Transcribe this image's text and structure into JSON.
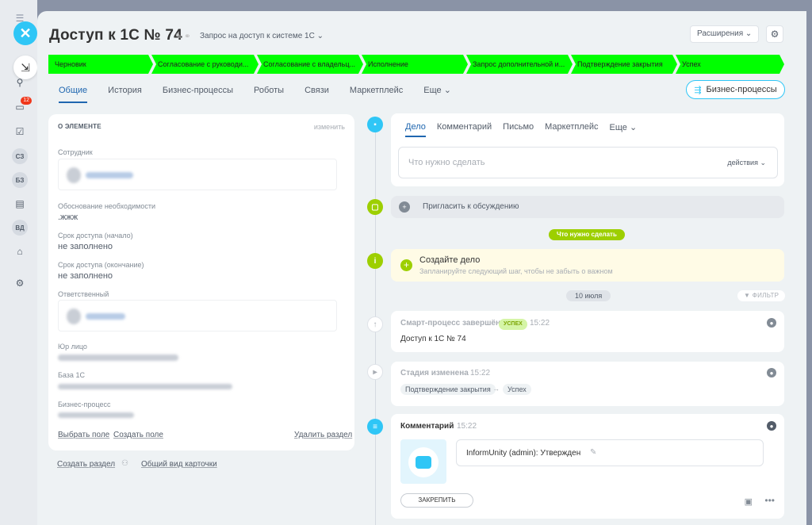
{
  "rail": {
    "close_icon": "close-icon",
    "badge": "12",
    "items": [
      "СЗ",
      "БЗ",
      "ВД"
    ]
  },
  "header": {
    "title": "Доступ к 1С № 74",
    "process": "Запрос на доступ к системе 1С",
    "extensions": "Расширения"
  },
  "stages": [
    {
      "label": "Черновик",
      "color": "#00ff00"
    },
    {
      "label": "Согласование с руководи...",
      "color": "#00ff00"
    },
    {
      "label": "Согласование с владельц...",
      "color": "#00ff00"
    },
    {
      "label": "Исполнение",
      "color": "#00ff00"
    },
    {
      "label": "Запрос дополнительной и...",
      "color": "#00ff00"
    },
    {
      "label": "Подтверждение закрытия",
      "color": "#00ff00"
    },
    {
      "label": "Успех",
      "color": "#00ff00"
    }
  ],
  "tabs": [
    "Общие",
    "История",
    "Бизнес-процессы",
    "Роботы",
    "Связи",
    "Маркетплейс",
    "Еще"
  ],
  "bp_button": "Бизнес-процессы",
  "about": {
    "heading": "О ЭЛЕМЕНТЕ",
    "edit": "изменить",
    "fields": [
      {
        "label": "Сотрудник"
      },
      {
        "label": "Обоснование необходимости",
        "value": ".жжж"
      },
      {
        "label": "Срок доступа (начало)",
        "value": "не заполнено"
      },
      {
        "label": "Срок доступа (окончание)",
        "value": "не заполнено"
      },
      {
        "label": "Ответственный"
      },
      {
        "label": "Юр лицо"
      },
      {
        "label": "База 1С"
      },
      {
        "label": "Бизнес-процесс"
      }
    ],
    "select_field": "Выбрать поле",
    "create_field": "Создать поле",
    "delete_section": "Удалить раздел",
    "create_section": "Создать раздел",
    "card_view": "Общий вид карточки"
  },
  "editor": {
    "tabs": [
      "Дело",
      "Комментарий",
      "Письмо",
      "Маркетплейс",
      "Еще"
    ],
    "placeholder": "Что нужно сделать",
    "actions": "действия"
  },
  "invite": "Пригласить к обсуждению",
  "todo_pill": "Что нужно сделать",
  "create_task": {
    "title": "Создайте дело",
    "hint": "Запланируйте следующий шаг, чтобы не забыть о важном"
  },
  "date_pill": "10 июля",
  "filter": "ФИЛЬТР",
  "events": [
    {
      "title": "Смарт-процесс завершён",
      "badge": "УСПЕХ",
      "time": "15:22",
      "text": "Доступ к 1С № 74"
    },
    {
      "title": "Стадия изменена",
      "time": "15:22",
      "from": "Подтверждение закрытия",
      "to": "Успех"
    },
    {
      "title": "Комментарий",
      "time": "15:22",
      "text": "InformUnity (admin): Утвержден",
      "pin": "ЗАКРЕПИТЬ"
    }
  ]
}
